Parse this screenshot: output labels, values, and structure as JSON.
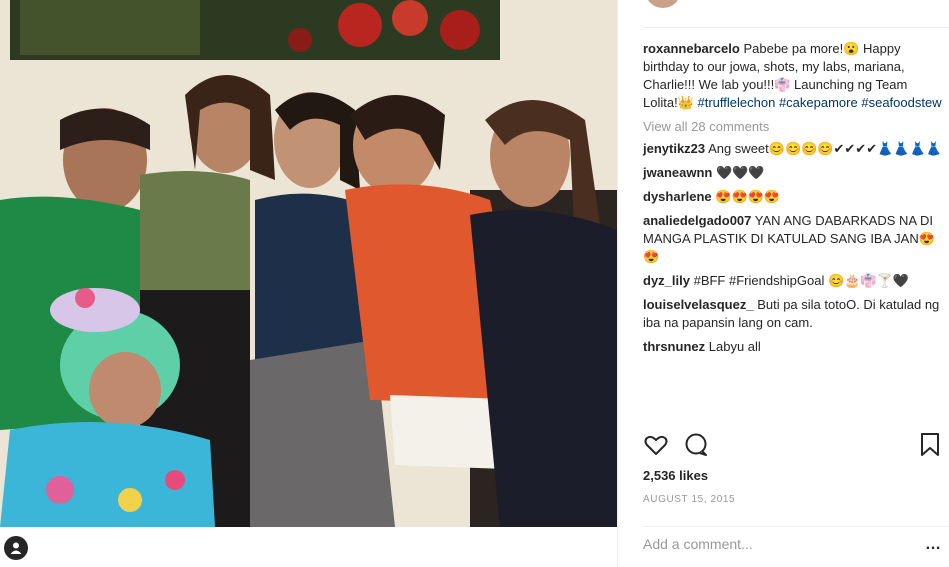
{
  "post": {
    "caption_user": "roxannebarcelo",
    "caption_text": "Pabebe pa more!😮 Happy birthday to our jowa, shots, my labs, mariana, Charlie!!! We lab you!!!👘 Launching ng Team Lolita!👑 ",
    "hashtags": [
      "#trufflelechon",
      "#cakepamore",
      "#seafoodstew"
    ],
    "view_all": "View all 28 comments",
    "likes": "2,536 likes",
    "date": "AUGUST 15, 2015",
    "add_comment_placeholder": "Add a comment...",
    "more": "…"
  },
  "comments": [
    {
      "user": "jenytikz23",
      "text": "Ang sweet😊😊😊😊✔✔✔✔👗👗👗👗"
    },
    {
      "user": "jwaneawnn",
      "text": "🖤🖤🖤"
    },
    {
      "user": "dysharlene",
      "text": "😍😍😍😍"
    },
    {
      "user": "analiedelgado007",
      "text": "YAN ANG DABARKADS NA DI MANGA PLASTIK DI KATULAD SANG IBA JAN😍😍"
    },
    {
      "user": "dyz_lily",
      "text": "#BFF #FriendshipGoal 😊🎂👘🍸🖤"
    },
    {
      "user": "louiselvelasquez_",
      "text": "Buti pa sila totoO. Di katulad ng iba na papansin lang on cam."
    },
    {
      "user": "thrsnunez",
      "text": "Labyu all"
    }
  ],
  "icons": {
    "like": "heart-icon",
    "comment": "comment-icon",
    "save": "bookmark-icon",
    "tag": "person-tag-icon"
  },
  "colors": {
    "text": "#262626",
    "muted": "#999999",
    "hashtag": "#003569",
    "divider": "#efefef"
  }
}
